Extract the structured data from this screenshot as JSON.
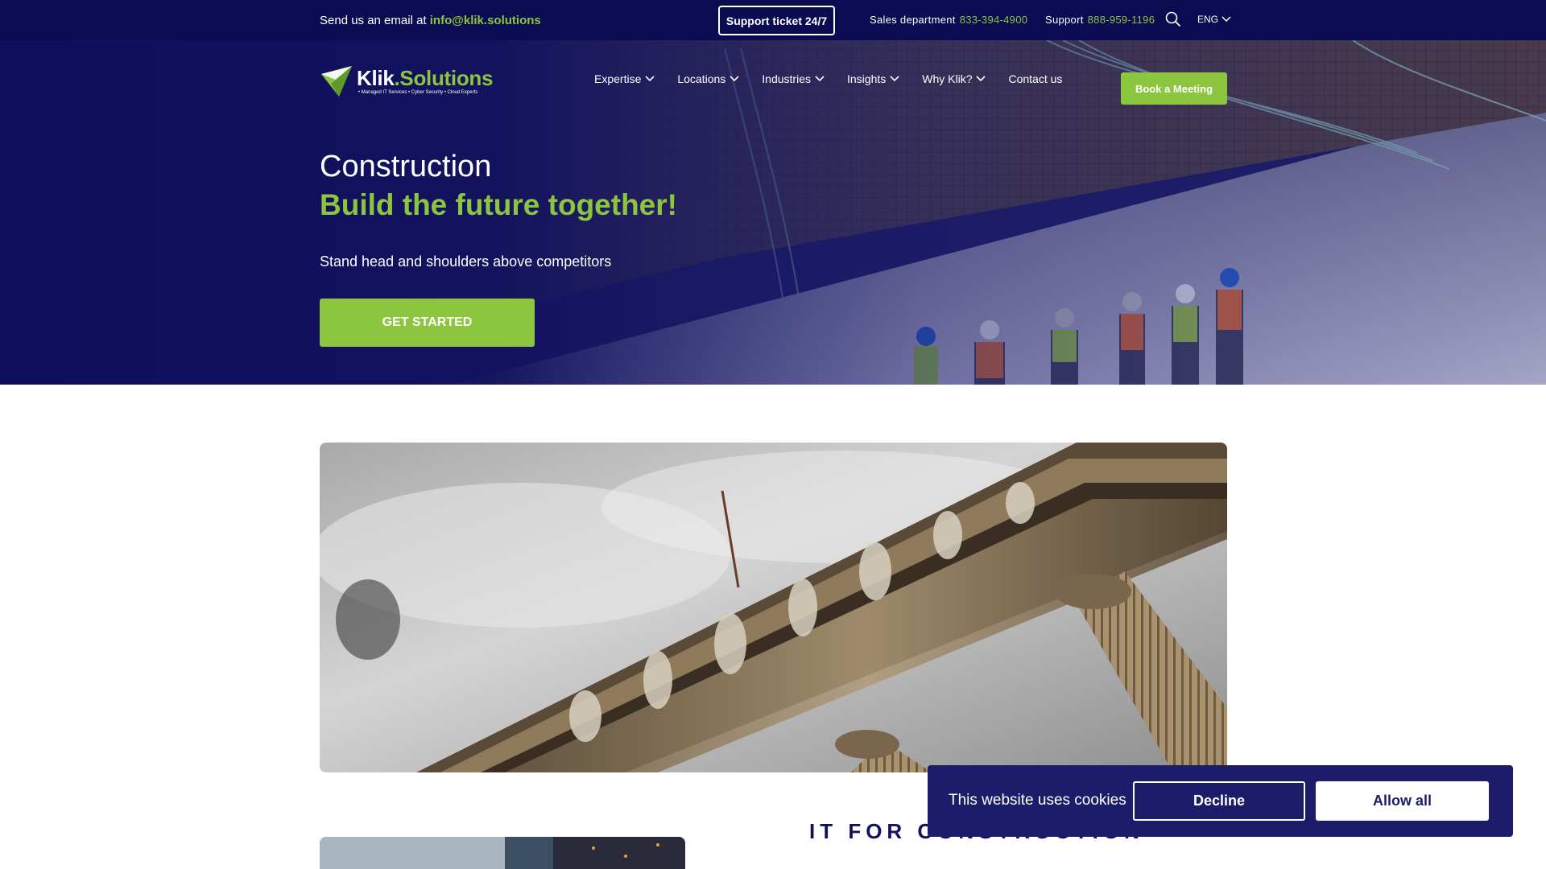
{
  "topbar": {
    "email_prefix": "Send us an email at",
    "email": "info@klik.solutions",
    "support_ticket": "Support ticket 24/7",
    "sales_label": "Sales department",
    "sales_phone": "833-394-4900",
    "support_label": "Support",
    "support_phone": "888-959-1196",
    "language": "ENG"
  },
  "brand": {
    "name_main": "Klik",
    "name_dot": ".",
    "name_rest": "Solutions",
    "tagline": "• Managed IT Services • Cyber Security • Cloud Experts"
  },
  "nav": {
    "items": [
      {
        "label": "Expertise"
      },
      {
        "label": "Locations"
      },
      {
        "label": "Industries"
      },
      {
        "label": "Insights"
      },
      {
        "label": "Why Klik?"
      },
      {
        "label": "Contact us"
      }
    ],
    "book_label": "Book a Meeting"
  },
  "hero": {
    "title": "Construction",
    "subtitle": "Build the future together!",
    "tagline": "Stand head and shoulders above competitors",
    "cta": "GET STARTED"
  },
  "content": {
    "section_heading": "IT FOR CONSTRUCTION"
  },
  "cookie": {
    "message": "This website uses cookies",
    "decline": "Decline",
    "allow": "Allow all"
  },
  "colors": {
    "navy": "#0b0b52",
    "accent_green": "#8cc63f",
    "banner": "#1c1c6b"
  }
}
